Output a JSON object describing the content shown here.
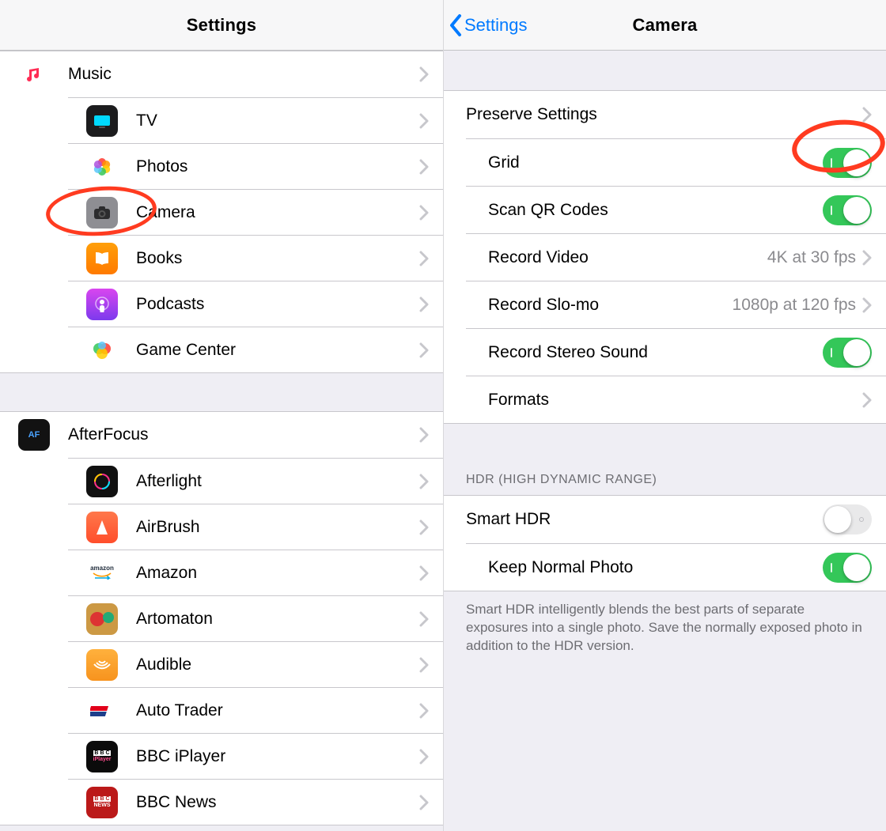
{
  "left": {
    "title": "Settings",
    "groups": [
      [
        {
          "icon": "music",
          "label": "Music"
        },
        {
          "icon": "tv",
          "label": "TV"
        },
        {
          "icon": "photos",
          "label": "Photos"
        },
        {
          "icon": "camera",
          "label": "Camera",
          "highlighted": true
        },
        {
          "icon": "books",
          "label": "Books"
        },
        {
          "icon": "podcasts",
          "label": "Podcasts"
        },
        {
          "icon": "gamecenter",
          "label": "Game Center"
        }
      ],
      [
        {
          "icon": "afterfocus",
          "label": "AfterFocus"
        },
        {
          "icon": "afterlight",
          "label": "Afterlight"
        },
        {
          "icon": "airbrush",
          "label": "AirBrush"
        },
        {
          "icon": "amazon",
          "label": "Amazon"
        },
        {
          "icon": "artomaton",
          "label": "Artomaton"
        },
        {
          "icon": "audible",
          "label": "Audible"
        },
        {
          "icon": "autotrader",
          "label": "Auto Trader"
        },
        {
          "icon": "bbciplayer",
          "label": "BBC iPlayer"
        },
        {
          "icon": "bbcnews",
          "label": "BBC News"
        }
      ]
    ]
  },
  "right": {
    "back_label": "Settings",
    "title": "Camera",
    "group1": [
      {
        "kind": "nav",
        "label": "Preserve Settings"
      },
      {
        "kind": "toggle",
        "label": "Grid",
        "on": true,
        "highlighted": true
      },
      {
        "kind": "toggle",
        "label": "Scan QR Codes",
        "on": true
      },
      {
        "kind": "nav",
        "label": "Record Video",
        "value": "4K at 30 fps"
      },
      {
        "kind": "nav",
        "label": "Record Slo-mo",
        "value": "1080p at 120 fps"
      },
      {
        "kind": "toggle",
        "label": "Record Stereo Sound",
        "on": true
      },
      {
        "kind": "nav",
        "label": "Formats"
      }
    ],
    "section2_header": "HDR (HIGH DYNAMIC RANGE)",
    "group2": [
      {
        "kind": "toggle",
        "label": "Smart HDR",
        "on": false
      },
      {
        "kind": "toggle",
        "label": "Keep Normal Photo",
        "on": true
      }
    ],
    "footer": "Smart HDR intelligently blends the best parts of separate exposures into a single photo. Save the normally exposed photo in addition to the HDR version."
  },
  "colors": {
    "accent": "#007aff",
    "toggle_on": "#34c759",
    "annotation": "#ff3b20"
  }
}
